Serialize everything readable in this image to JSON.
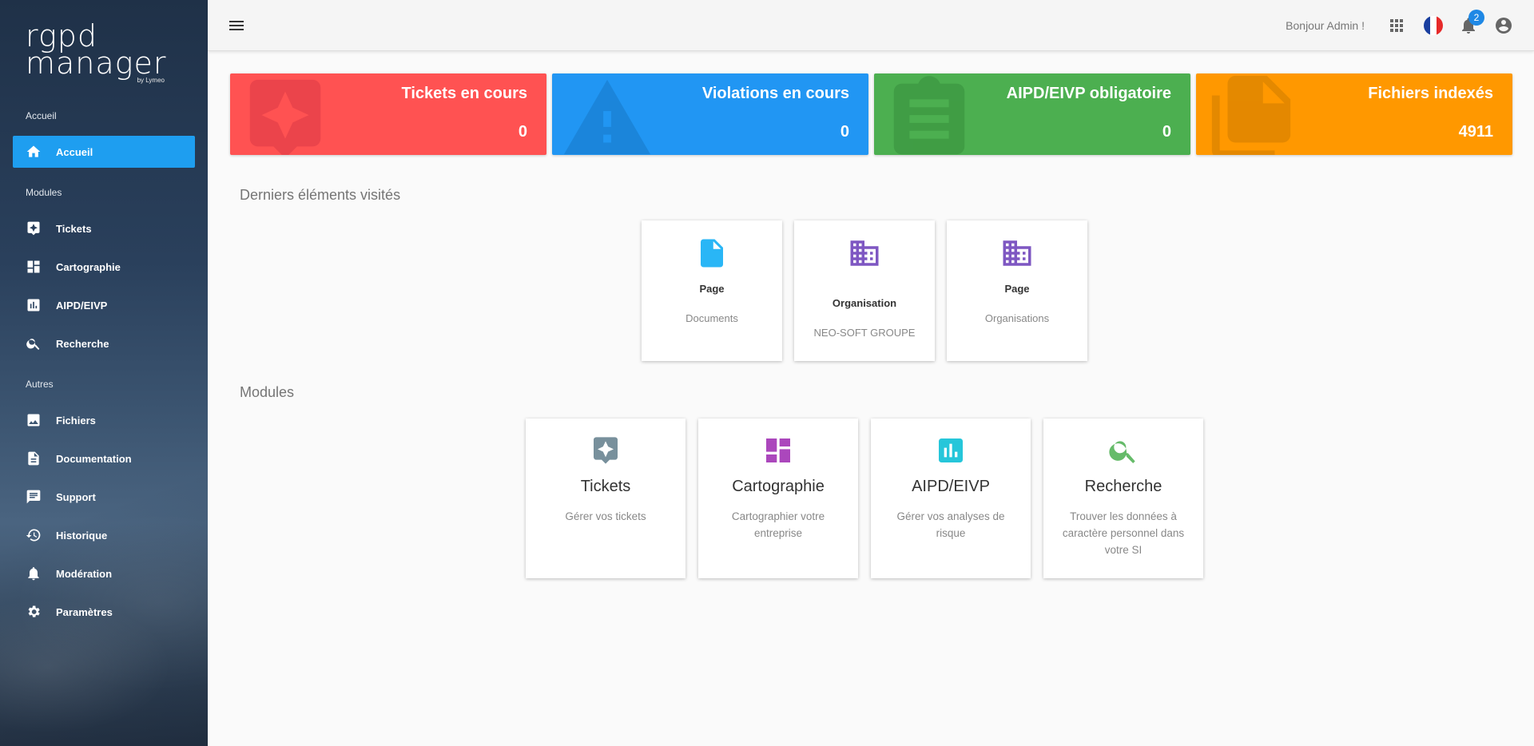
{
  "logo": {
    "line1": "rgpd",
    "line2": "manager",
    "byline": "by Lymeo"
  },
  "sidebar": {
    "sections": {
      "accueil": "Accueil",
      "modules": "Modules",
      "autres": "Autres"
    },
    "items": [
      {
        "label": "Accueil",
        "icon": "home-icon",
        "active": true
      },
      {
        "label": "Tickets",
        "icon": "ticket-icon"
      },
      {
        "label": "Cartographie",
        "icon": "dashboard-icon"
      },
      {
        "label": "AIPD/EIVP",
        "icon": "chart-icon"
      },
      {
        "label": "Recherche",
        "icon": "search-icon"
      },
      {
        "label": "Fichiers",
        "icon": "image-icon"
      },
      {
        "label": "Documentation",
        "icon": "document-icon"
      },
      {
        "label": "Support",
        "icon": "chat-icon"
      },
      {
        "label": "Historique",
        "icon": "history-icon"
      },
      {
        "label": "Modération",
        "icon": "bell-icon"
      },
      {
        "label": "Paramètres",
        "icon": "gear-icon"
      }
    ]
  },
  "topbar": {
    "greeting": "Bonjour Admin !",
    "notifications_count": "2"
  },
  "stats": [
    {
      "title": "Tickets en cours",
      "value": "0",
      "color": "#ff5252"
    },
    {
      "title": "Violations en cours",
      "value": "0",
      "color": "#2196f3"
    },
    {
      "title": "AIPD/EIVP obligatoire",
      "value": "0",
      "color": "#4caf50"
    },
    {
      "title": "Fichiers indexés",
      "value": "4911",
      "color": "#ff9800"
    }
  ],
  "recent": {
    "heading": "Derniers éléments visités",
    "items": [
      {
        "type": "Page",
        "name": "Documents",
        "icon": "file-icon"
      },
      {
        "type": "Organisation",
        "name": "NEO-SOFT GROUPE",
        "icon": "building-icon"
      },
      {
        "type": "Page",
        "name": "Organisations",
        "icon": "building-icon"
      }
    ]
  },
  "modules": {
    "heading": "Modules",
    "items": [
      {
        "title": "Tickets",
        "desc": "Gérer vos tickets",
        "icon": "ticket-icon",
        "color": "#78909c"
      },
      {
        "title": "Cartographie",
        "desc": "Cartographier votre entreprise",
        "icon": "dashboard-icon",
        "color": "#ab47bc"
      },
      {
        "title": "AIPD/EIVP",
        "desc": "Gérer vos analyses de risque",
        "icon": "chart-icon",
        "color": "#26c6da"
      },
      {
        "title": "Recherche",
        "desc": "Trouver les données à caractère personnel dans votre SI",
        "icon": "search-icon",
        "color": "#66bb6a"
      }
    ]
  }
}
